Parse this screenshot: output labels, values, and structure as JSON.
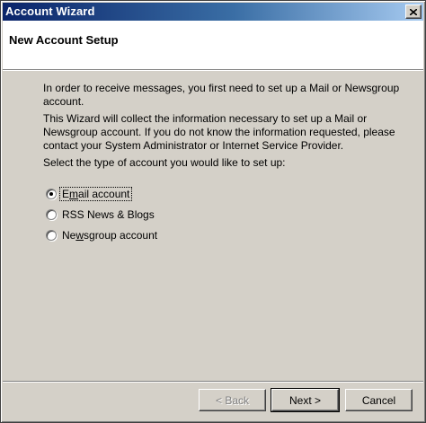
{
  "window": {
    "title": "Account Wizard",
    "close_icon": "close-icon"
  },
  "header": {
    "title": "New Account Setup"
  },
  "content": {
    "paragraph1": "In order to receive messages, you first need to set up a Mail or Newsgroup account.",
    "paragraph2": "This Wizard will collect the information necessary to set up a Mail or Newsgroup account. If you do not know the information requested, please contact your System Administrator or Internet Service Provider.",
    "paragraph3": "Select the type of account you would like to set up:"
  },
  "account_types": [
    {
      "pre": "E",
      "accel": "m",
      "post": "ail account",
      "selected": true
    },
    {
      "pre": "RSS News & Blogs",
      "accel": "",
      "post": "",
      "selected": false
    },
    {
      "pre": "Ne",
      "accel": "w",
      "post": "sgroup account",
      "selected": false
    }
  ],
  "buttons": {
    "back": "< Back",
    "next": "Next >",
    "cancel": "Cancel"
  }
}
